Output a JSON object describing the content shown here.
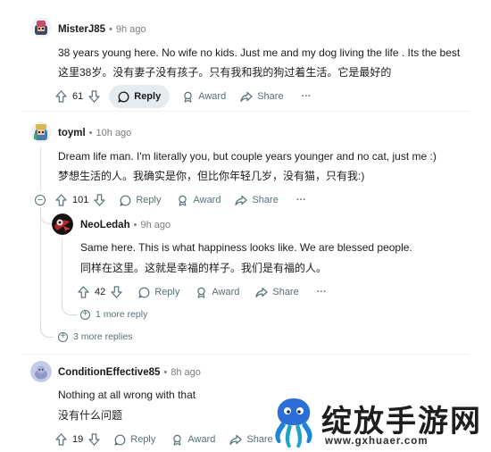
{
  "comments": [
    {
      "username": "MisterJ85",
      "time": "9h ago",
      "text_en": "38 years young here. No wife no kids. Just me and my dog living the life . Its the best",
      "text_zh": "这里38岁。没有妻子没有孩子。只有我和我的狗过着生活。它是最好的",
      "votes": "61",
      "reply_label": "Reply",
      "award_label": "Award",
      "share_label": "Share",
      "more_label": "···"
    },
    {
      "username": "toyml",
      "time": "10h ago",
      "text_en": "Dream life man. I'm literally you, but couple years younger and no cat, just me :)",
      "text_zh": "梦想生活的人。我确实是你，但比你年轻几岁，没有猫，只有我:)",
      "votes": "101",
      "reply_label": "Reply",
      "award_label": "Award",
      "share_label": "Share",
      "more_label": "···",
      "collapse_symbol": "−"
    },
    {
      "username": "NeoLedah",
      "time": "9h ago",
      "text_en": "Same here. This is what happiness looks like. We are blessed people.",
      "text_zh": "同样在这里。这就是幸福的样子。我们是有福的人。",
      "votes": "42",
      "reply_label": "Reply",
      "award_label": "Award",
      "share_label": "Share",
      "more_label": "···"
    },
    {
      "username": "ConditionEffective85",
      "time": "8h ago",
      "text_en": "Nothing at all wrong with that",
      "text_zh": "没有什么问题",
      "votes": "19",
      "reply_label": "Reply",
      "award_label": "Award",
      "share_label": "Share",
      "more_label": "···"
    }
  ],
  "more_reply_label": "1 more reply",
  "more_replies_label": "3 more replies",
  "expand_symbol": "+",
  "watermark": {
    "cn": "绽放手游网",
    "url": "www.gxhuaer.com"
  },
  "colors": {
    "text": "#1c1c1c",
    "meta": "#576f76",
    "reply_pill": "#e5ebee",
    "thread_line": "#e3e6e8"
  }
}
